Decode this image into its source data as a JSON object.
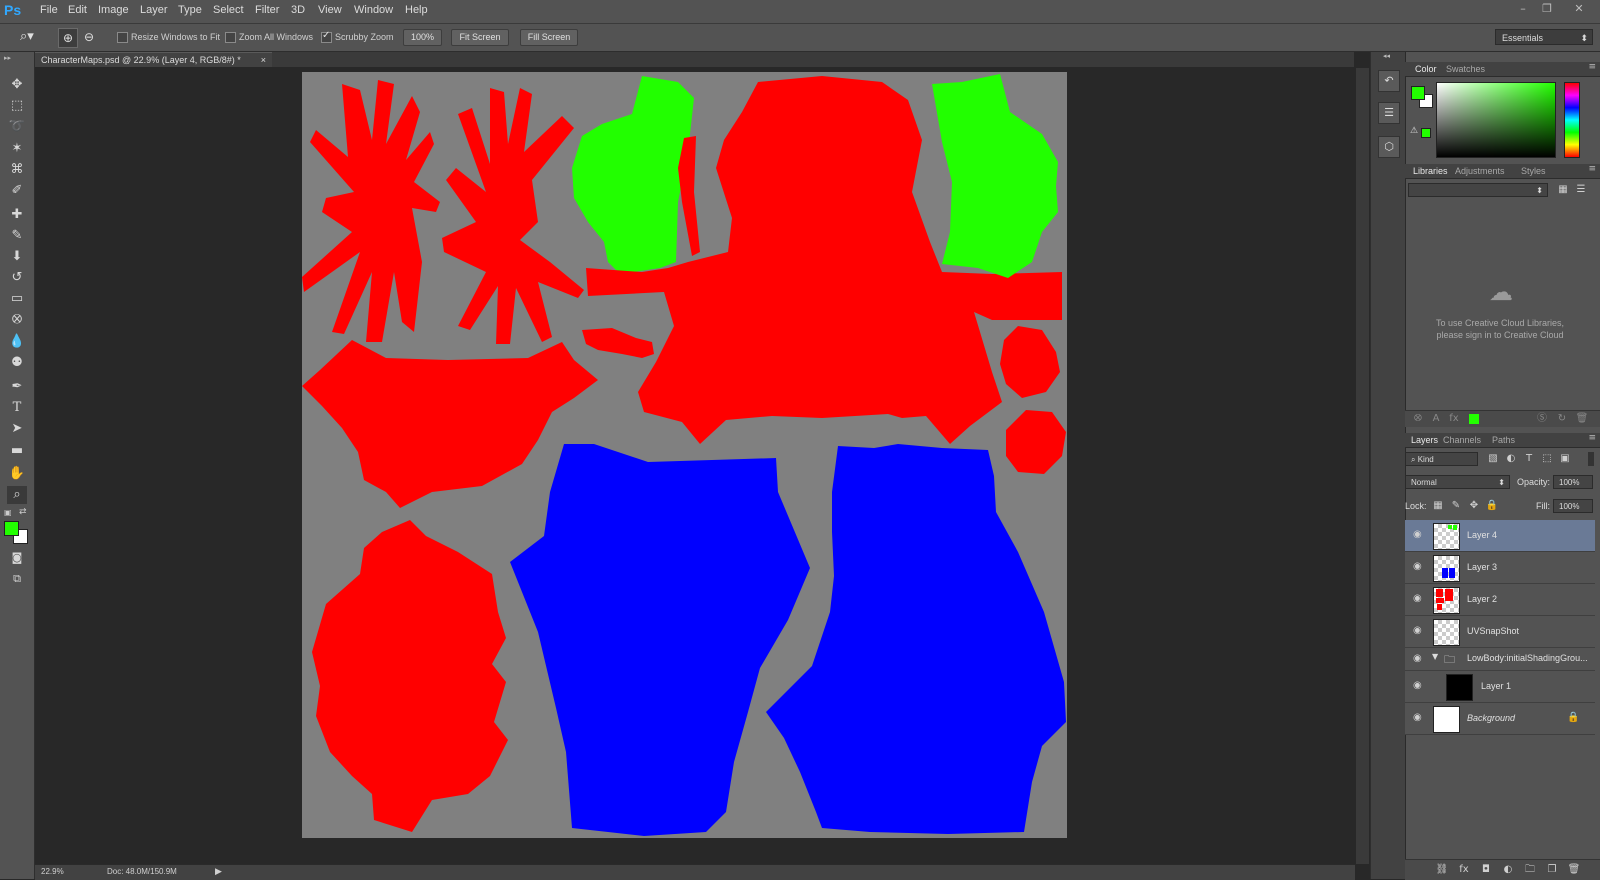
{
  "app": {
    "logo": "Ps"
  },
  "menu": [
    "File",
    "Edit",
    "Image",
    "Layer",
    "Type",
    "Select",
    "Filter",
    "3D",
    "View",
    "Window",
    "Help"
  ],
  "window_controls": {
    "minimize": "–",
    "restore": "❐",
    "close": "✕"
  },
  "options": {
    "resize_windows": "Resize Windows to Fit",
    "zoom_all": "Zoom All Windows",
    "scrubby": "Scrubby Zoom",
    "zoom_value": "100%",
    "fit_screen": "Fit Screen",
    "fill_screen": "Fill Screen",
    "workspace": "Essentials"
  },
  "document": {
    "tab_title": "CharacterMaps.psd @ 22.9% (Layer 4, RGB/8#) *",
    "tab_close": "×",
    "zoom": "22.9%",
    "doc_info": "Doc: 48.0M/150.9M"
  },
  "colors": {
    "foreground": "#22ff00",
    "background": "#ffffff",
    "canvas_gray": "#808080",
    "uv_red": "#ff0000",
    "uv_green": "#22ff00",
    "uv_blue": "#0000ff",
    "selected_layer": "#6a7a96"
  },
  "color_panel": {
    "tabs": [
      "Color",
      "Swatches"
    ]
  },
  "libraries_panel": {
    "tabs": [
      "Libraries",
      "Adjustments",
      "Styles"
    ],
    "message_line1": "To use Creative Cloud Libraries,",
    "message_line2": "please sign in to Creative Cloud"
  },
  "layers_panel": {
    "tabs": [
      "Layers",
      "Channels",
      "Paths"
    ],
    "filter": "Kind",
    "blend_mode": "Normal",
    "opacity_label": "Opacity:",
    "opacity": "100%",
    "lock_label": "Lock:",
    "fill_label": "Fill:",
    "fill": "100%",
    "layers": [
      {
        "name": "Layer 4",
        "selected": true
      },
      {
        "name": "Layer 3",
        "selected": false
      },
      {
        "name": "Layer 2",
        "selected": false
      },
      {
        "name": "UVSnapShot",
        "selected": false
      },
      {
        "name": "LowBody:initialShadingGrou...",
        "selected": false,
        "group": true
      },
      {
        "name": "Layer 1",
        "selected": false
      },
      {
        "name": "Background",
        "selected": false,
        "locked": true
      }
    ]
  }
}
